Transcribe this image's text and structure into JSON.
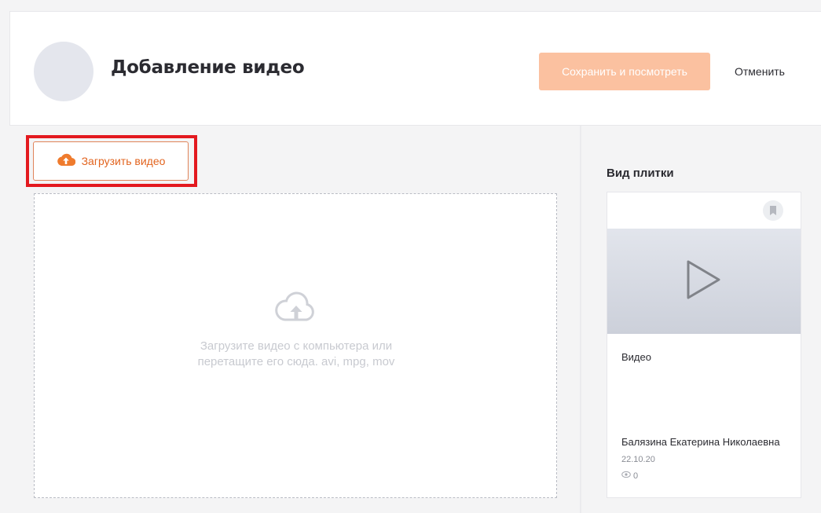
{
  "header": {
    "title": "Добавление видео",
    "save_label": "Сохранить и посмотреть",
    "cancel_label": "Отменить"
  },
  "upload": {
    "button_label": "Загрузить видео",
    "icon": "cloud-upload-icon"
  },
  "dropzone": {
    "icon": "cloud-upload-icon",
    "line1": "Загрузите видео с компьютера или",
    "line2": "перетащите его сюда. avi, mpg, mov"
  },
  "preview": {
    "section_title": "Вид плитки",
    "tile_title": "Видео",
    "author": "Балязина Екатерина Николаевна",
    "date": "22.10.20",
    "views": "0"
  },
  "colors": {
    "accent": "#e2641f",
    "save_button": "#fbc1a0",
    "highlight": "#e3191f"
  }
}
